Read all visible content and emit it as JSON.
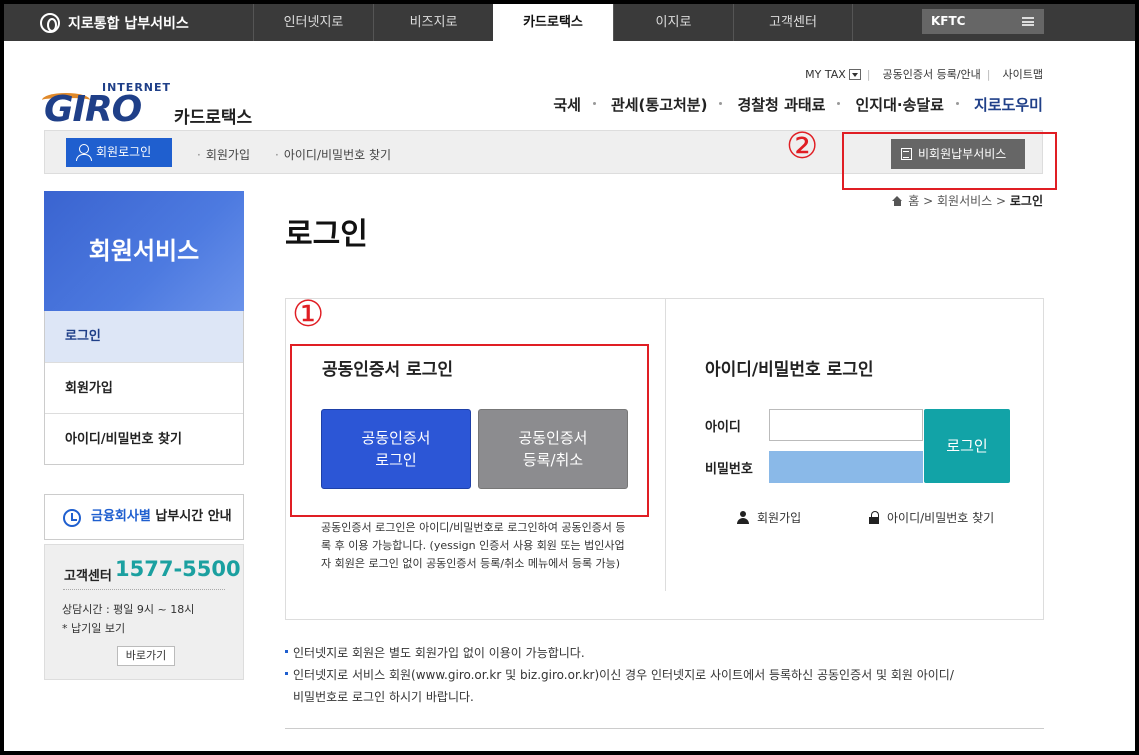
{
  "topbar": {
    "brand": "지로통합 납부서비스",
    "tabs": [
      "인터넷지로",
      "비즈지로",
      "카드로택스",
      "이지로",
      "고객센터"
    ],
    "active_tab": "카드로택스",
    "kftc": "KFTC"
  },
  "logo": {
    "internet": "INTERNET",
    "giro": "GIRO",
    "sub": "카드로택스"
  },
  "util": {
    "mytax": "MY TAX",
    "cert": "공동인증서 등록/안내",
    "sitemap": "사이트맵"
  },
  "mainnav": [
    "국세",
    "관세(통고처분)",
    "경찰청 과태료",
    "인지대·송달료",
    "지로도우미"
  ],
  "strip": {
    "login": "회원로그인",
    "signup": "회원가입",
    "find": "아이디/비밀번호 찾기",
    "nonmember": "비회원납부서비스"
  },
  "annotations": {
    "one": "①",
    "two": "②"
  },
  "breadcrumb": {
    "home": "홈",
    "service": "회원서비스",
    "current": "로그인"
  },
  "sidebar": {
    "title": "회원서비스",
    "items": [
      "로그인",
      "회원가입",
      "아이디/비밀번호 찾기"
    ],
    "time_hl": "금융회사별",
    "time_rest": " 납부시간 안내",
    "cs_label": "고객센터",
    "cs_phone": "1577-5500",
    "cs_hours": "상담시간 : 평일 9시 ~ 18시",
    "cs_due": "* 납기일 보기",
    "cs_go": "바로가기"
  },
  "main": {
    "title": "로그인",
    "cert_title": "공동인증서 로그인",
    "cert_login": "공동인증서\n로그인",
    "cert_register": "공동인증서\n등록/취소",
    "cert_note": "공동인증서 로그인은 아이디/비밀번호로 로그인하여 공동인증서 등록 후 이용 가능합니다. (yessign 인증서 사용 회원 또는 법인사업자 회원은 로그인 없이 공동인증서 등록/취소 메뉴에서 등록 가능)",
    "id_title": "아이디/비밀번호 로그인",
    "id_label": "아이디",
    "pw_label": "비밀번호",
    "id_login": "로그인",
    "link_signup": "회원가입",
    "link_find": "아이디/비밀번호 찾기"
  },
  "notes": [
    "인터넷지로 회원은 별도 회원가입 없이 이용이 가능합니다.",
    "인터넷지로 서비스 회원(www.giro.or.kr 및 biz.giro.or.kr)이신 경우 인터넷지로 사이트에서 등록하신 공동인증서 및 회원 아이디/",
    "비밀번호로 로그인 하시기 바랍니다."
  ]
}
